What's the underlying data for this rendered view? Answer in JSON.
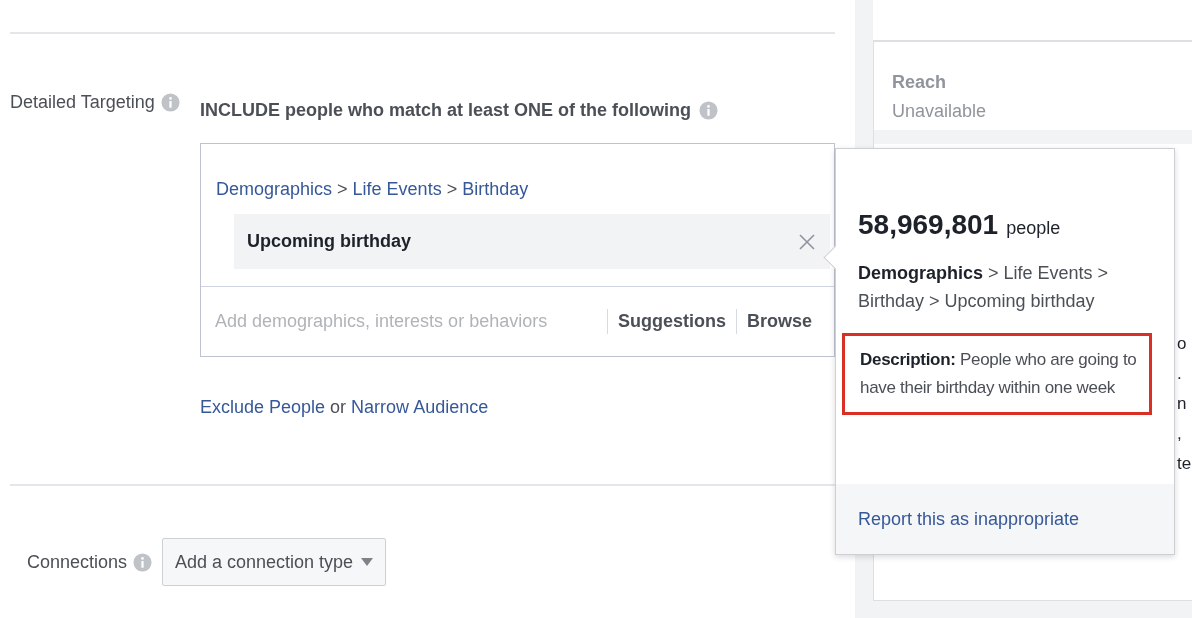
{
  "targeting": {
    "label": "Detailed Targeting",
    "include_text": "INCLUDE people who match at least ONE of the following",
    "breadcrumb": [
      {
        "kind": "link",
        "text": "Demographics"
      },
      {
        "kind": "separator",
        "text": ">"
      },
      {
        "kind": "link",
        "text": "Life Events"
      },
      {
        "kind": "separator",
        "text": ">"
      },
      {
        "kind": "link",
        "text": "Birthday"
      }
    ],
    "chip": "Upcoming birthday",
    "search": {
      "placeholder": "Add demographics, interests or behaviors"
    },
    "actions": [
      "Suggestions",
      "Browse"
    ],
    "links": [
      {
        "kind": "link",
        "text": "Exclude People"
      },
      {
        "kind": "text",
        "text": "or"
      },
      {
        "kind": "link",
        "text": "Narrow Audience"
      }
    ]
  },
  "connections": {
    "label": "Connections",
    "dropdown": "Add a connection type"
  },
  "side_panel": {
    "reach_label": "Reach",
    "reach_value": "Unavailable",
    "fragments": [
      "o",
      ".",
      "n",
      ",",
      "te"
    ]
  },
  "popup": {
    "count": "58,969,801",
    "unit": "people",
    "path": "**Demographics** > Life Events > Birthday > Upcoming birthday",
    "description": "**Description:** People who are going to have their birthday within one week",
    "highlighted": true,
    "report_link": "Report this as inappropriate"
  }
}
